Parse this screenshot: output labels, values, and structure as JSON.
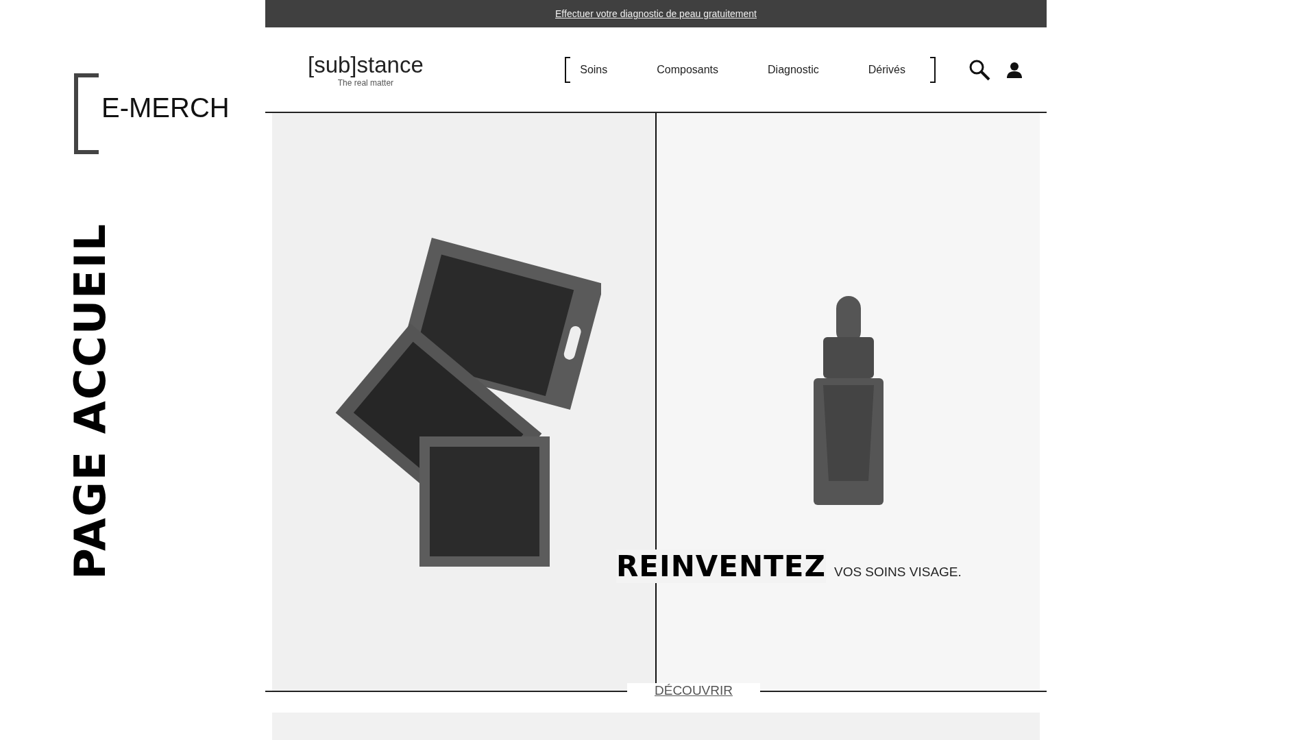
{
  "slide": {
    "section": "E-MERCH",
    "title": "PAGE ACCUEIL"
  },
  "site": {
    "announcement": "Effectuer votre diagnostic de peau gratuitement",
    "logo": {
      "name": "[sub]stance",
      "tagline": "The real matter"
    },
    "nav": [
      {
        "label": "Soins"
      },
      {
        "label": "Composants"
      },
      {
        "label": "Diagnostic"
      },
      {
        "label": "Dérivés"
      }
    ],
    "hero": {
      "headline": "REINVENTEZ",
      "subline": "VOS SOINS VISAGE.",
      "cta": "DÉCOUVRIR"
    }
  }
}
